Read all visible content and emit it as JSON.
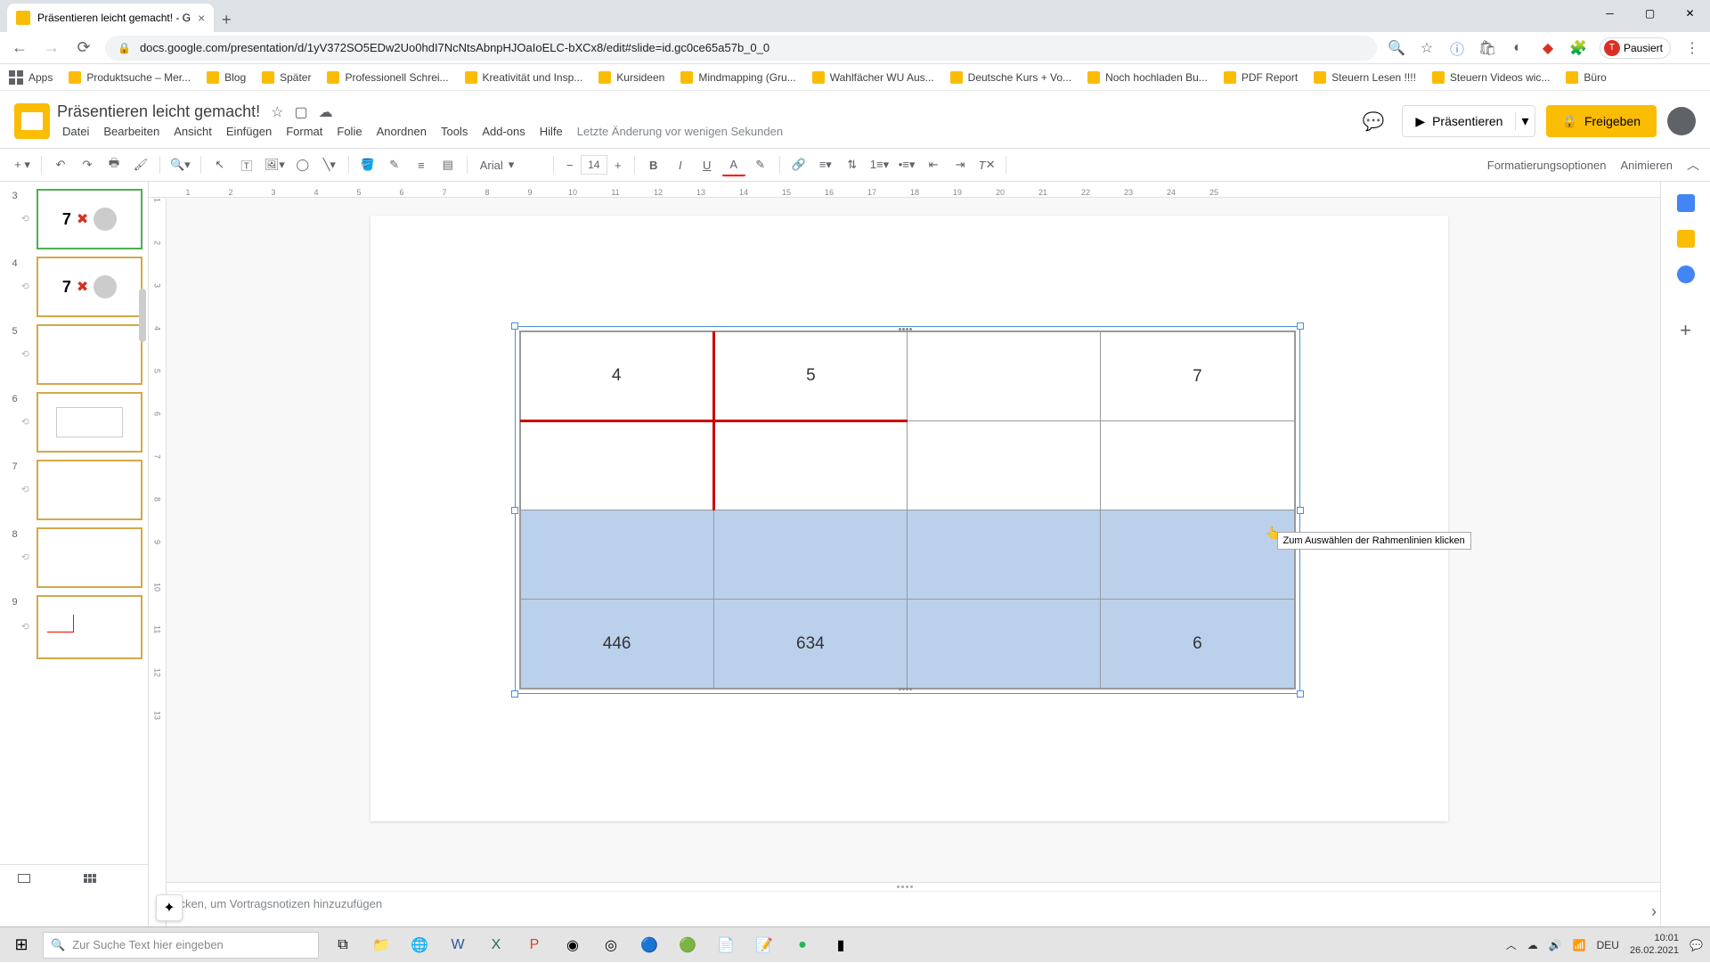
{
  "browser": {
    "tab_title": "Präsentieren leicht gemacht! - G",
    "url": "docs.google.com/presentation/d/1yV372SO5EDw2Uo0hdI7NcNtsAbnpHJOaIoELC-bXCx8/edit#slide=id.gc0ce65a57b_0_0",
    "profile_status": "Pausiert"
  },
  "bookmarks": {
    "apps": "Apps",
    "items": [
      "Produktsuche – Mer...",
      "Blog",
      "Später",
      "Professionell Schrei...",
      "Kreativität und Insp...",
      "Kursideen",
      "Mindmapping (Gru...",
      "Wahlfächer WU Aus...",
      "Deutsche Kurs + Vo...",
      "Noch hochladen Bu...",
      "PDF Report",
      "Steuern Lesen !!!!",
      "Steuern Videos wic...",
      "Büro"
    ]
  },
  "app": {
    "doc_title": "Präsentieren leicht gemacht!",
    "last_edit": "Letzte Änderung vor wenigen Sekunden",
    "menus": [
      "Datei",
      "Bearbeiten",
      "Ansicht",
      "Einfügen",
      "Format",
      "Folie",
      "Anordnen",
      "Tools",
      "Add-ons",
      "Hilfe"
    ],
    "present": "Präsentieren",
    "share": "Freigeben"
  },
  "toolbar": {
    "font": "Arial",
    "font_size": "14",
    "format_options": "Formatierungsoptionen",
    "animate": "Animieren"
  },
  "ruler_h": [
    "1",
    "2",
    "3",
    "4",
    "5",
    "6",
    "7",
    "8",
    "9",
    "10",
    "11",
    "12",
    "13",
    "14",
    "15",
    "16",
    "17",
    "18",
    "19",
    "20",
    "21",
    "22",
    "23",
    "24",
    "25"
  ],
  "ruler_v": [
    "1",
    "2",
    "3",
    "4",
    "5",
    "6",
    "7",
    "8",
    "9",
    "10",
    "11",
    "12",
    "13"
  ],
  "filmstrip": {
    "slides": [
      {
        "num": "3"
      },
      {
        "num": "4"
      },
      {
        "num": "5"
      },
      {
        "num": "6"
      },
      {
        "num": "7"
      },
      {
        "num": "8"
      },
      {
        "num": "9"
      }
    ]
  },
  "table": {
    "rows": [
      [
        "4",
        "5",
        "",
        "7"
      ],
      [
        "",
        "",
        "",
        ""
      ],
      [
        "",
        "",
        "",
        ""
      ],
      [
        "446",
        "634",
        "",
        "6"
      ]
    ]
  },
  "tooltip": "Zum Auswählen der Rahmenlinien klicken",
  "notes_placeholder": "Klicken, um Vortragsnotizen hinzuzufügen",
  "taskbar": {
    "search_placeholder": "Zur Suche Text hier eingeben",
    "lang": "DEU",
    "time": "10:01",
    "date": "26.02.2021"
  }
}
